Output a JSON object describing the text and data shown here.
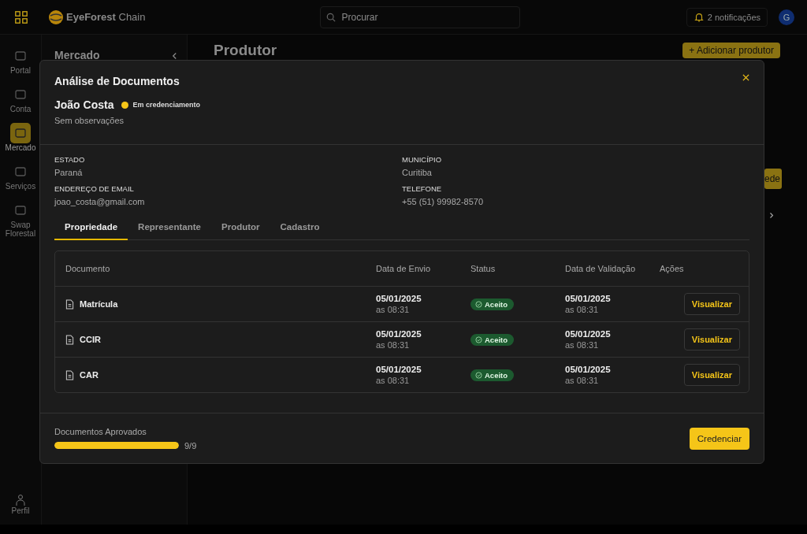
{
  "topbar": {
    "brand": "EyeForest",
    "brand_suffix": "Chain",
    "search": {
      "placeholder": "Procurar"
    },
    "notifications": "2 notificações",
    "avatar": "G"
  },
  "sidebar": {
    "items": [
      {
        "label": "Portal",
        "selected": false
      },
      {
        "label": "Conta",
        "selected": false
      },
      {
        "label": "Mercado",
        "selected": true
      },
      {
        "label": "Serviços",
        "selected": false
      },
      {
        "label": "Swap Florestal",
        "selected": false
      }
    ],
    "profile": "Perfil"
  },
  "panel": {
    "title": "Mercado"
  },
  "page": {
    "title": "Produtor",
    "add_button": "+ Adicionar produtor",
    "partial_button": "ede"
  },
  "modal": {
    "title": "Análise de Documentos",
    "name": "João Costa",
    "status": {
      "label": "Em credenciamento",
      "color": "#f5c518"
    },
    "notes": "Sem observações",
    "fields": [
      {
        "label": "ESTADO",
        "value": "Paraná"
      },
      {
        "label": "MUNICÍPIO",
        "value": "Curitiba"
      },
      {
        "label": "ENDEREÇO DE EMAIL",
        "value": "joao_costa@gmail.com"
      },
      {
        "label": "TELEFONE",
        "value": "+55 (51) 99982-8570"
      }
    ],
    "tabs": [
      {
        "label": "Propriedade",
        "selected": true
      },
      {
        "label": "Representante",
        "selected": false
      },
      {
        "label": "Produtor",
        "selected": false
      },
      {
        "label": "Cadastro",
        "selected": false
      }
    ],
    "table": {
      "columns": [
        "Documento",
        "Data de Envio",
        "Status",
        "Data de Validação",
        "Ações"
      ],
      "rows": [
        {
          "document": "Matrícula",
          "sent_date": "05/01/2025",
          "sent_time": "as 08:31",
          "status": "Aceito",
          "validated_date": "05/01/2025",
          "validated_time": "as 08:31",
          "action": "Visualizar"
        },
        {
          "document": "CCIR",
          "sent_date": "05/01/2025",
          "sent_time": "as 08:31",
          "status": "Aceito",
          "validated_date": "05/01/2025",
          "validated_time": "as 08:31",
          "action": "Visualizar"
        },
        {
          "document": "CAR",
          "sent_date": "05/01/2025",
          "sent_time": "as 08:31",
          "status": "Aceito",
          "validated_date": "05/01/2025",
          "validated_time": "as 08:31",
          "action": "Visualizar"
        }
      ]
    },
    "footer": {
      "label": "Documentos Aprovados",
      "level": 1,
      "count": "9/9",
      "button": "Credenciar"
    }
  }
}
